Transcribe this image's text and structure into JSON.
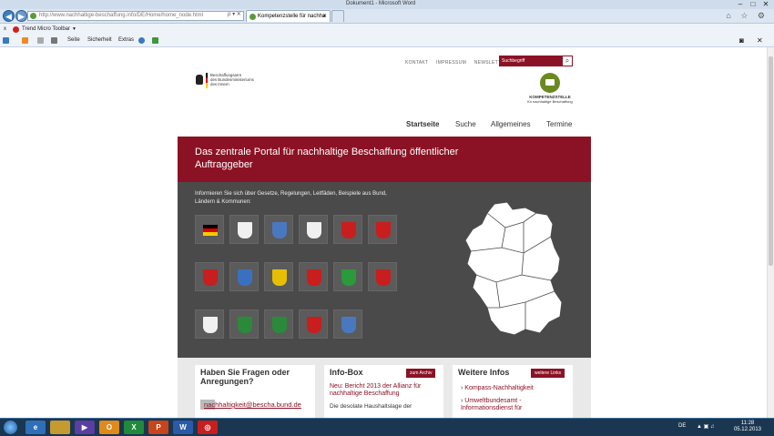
{
  "window": {
    "title": "Dokument1 - Microsoft Word",
    "minimize": "–",
    "maximize": "□",
    "close": "✕"
  },
  "nav": {
    "back": "◀",
    "forward": "▶",
    "url": "http://www.nachhaltige-beschaffung.info/DE/Home/home_node.html",
    "addr_icons": "ρ ▾ ✕",
    "tabs": [
      {
        "label": "Kompetenzstelle für nachha",
        "close": "✕"
      }
    ],
    "right_tools": "⌂ ☆ ⚙"
  },
  "toolbar": {
    "trend_micro": "Trend Micro Toolbar",
    "close": "x",
    "seite": "Seite",
    "sicherheit": "Sicherheit",
    "extras": "Extras"
  },
  "site": {
    "top_links": [
      "KONTAKT",
      "IMPRESSUM",
      "NEWSLETTER"
    ],
    "search_placeholder": "Suchbegriff",
    "search_icon": "⌕",
    "logo_lines": [
      "Beschaffungsamt",
      "des Bundesministeriums",
      "des Innern"
    ],
    "kz_title": "KOMPETENZSTELLE",
    "kz_sub": "für nachhaltige Beschaffung",
    "main_nav": [
      "Startseite",
      "Suche",
      "Allgemeines",
      "Termine"
    ],
    "banner": "Das zentrale Portal für nachhaltige Beschaffung öffentlicher Auftraggeber",
    "intro": "Informieren Sie sich über Gesetze, Regelungen, Leitfäden, Beispiele aus Bund, Ländern & Kommunen:",
    "crest_colors": [
      "#e0b000",
      "#f0f0f0",
      "#4a78c0",
      "#f0f0f0",
      "#c81e1e",
      "#c81e1e",
      "#c81e1e",
      "#3a70c0",
      "#e6c000",
      "#c81e1e",
      "#2a9a3a",
      "#c81e1e",
      "#f0f0f0",
      "#2a8a3a",
      "#2a8a3a",
      "#c81e1e",
      "#4a78c0"
    ],
    "boxes": {
      "fragen": {
        "title": "Haben Sie Fragen oder Anregungen?",
        "email": "nachhaltigkeit@bescha.bund.de"
      },
      "info": {
        "title": "Info-Box",
        "tag": "zum Archiv",
        "headline": "Neu: Bericht 2013 der Allianz für nachhaltige Beschaffung",
        "text": "Die desolate Haushaltslage der"
      },
      "links": {
        "title": "Weitere Infos",
        "tag": "weitere Links",
        "items": [
          "Kompass-Nachhaltigkeit",
          "Umweltbundesamt - Informationsdienst für"
        ]
      }
    }
  },
  "taskbar": {
    "lang": "DE",
    "time": "11:28",
    "date": "05.12.2013",
    "apps": [
      "e",
      "",
      "▶",
      "O",
      "X",
      "P",
      "W",
      "◎"
    ]
  }
}
